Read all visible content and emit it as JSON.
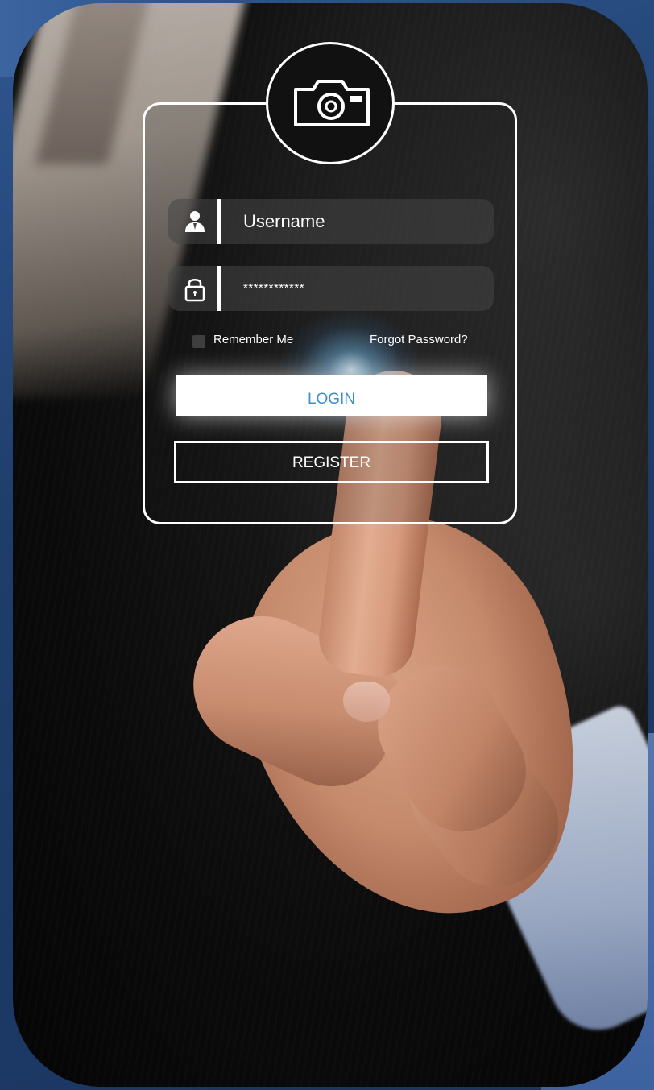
{
  "login_form": {
    "username_placeholder": "Username",
    "password_value": "************",
    "remember_label": "Remember Me",
    "forgot_label": "Forgot Password?",
    "login_label": "LOGIN",
    "register_label": "REGISTER"
  },
  "icons": {
    "header": "camera-icon",
    "username": "user-icon",
    "password": "lock-icon"
  },
  "colors": {
    "frame_blue": "#2f5790",
    "login_text": "#3a8fc9",
    "ui_stroke": "#ffffff"
  }
}
